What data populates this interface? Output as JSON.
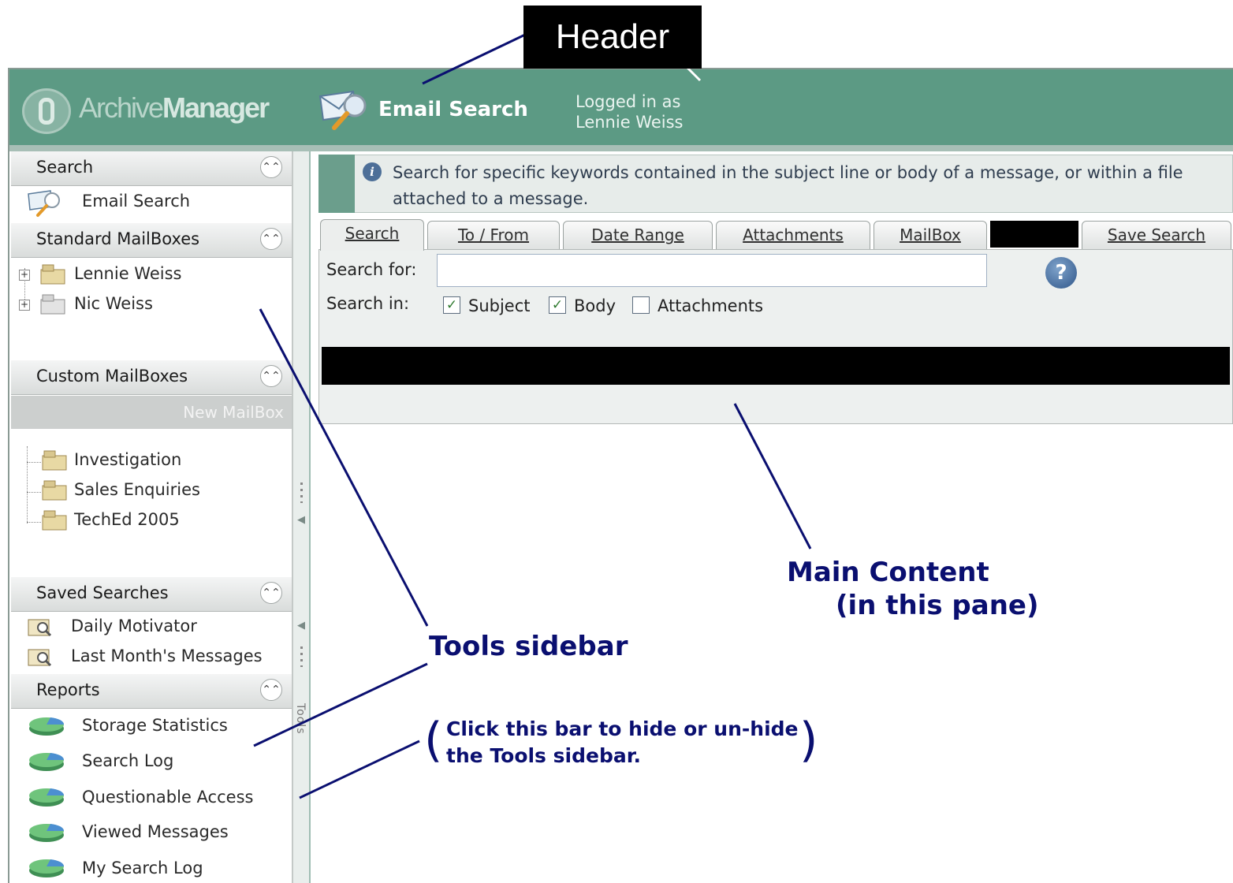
{
  "annotations": {
    "header": "Header",
    "main_content_line1": "Main Content",
    "main_content_line2": "(in this pane)",
    "tools_sidebar": "Tools sidebar",
    "toggle_line1": "Click this bar to hide or un-hide",
    "toggle_line2": "the Tools sidebar."
  },
  "header": {
    "logo_light": "Archive",
    "logo_bold": "Manager",
    "page_title": "Email Search",
    "logged_in_line1": "Logged in as",
    "logged_in_line2": "Lennie Weiss",
    "accent_color": "#5c9a84"
  },
  "sidebar": {
    "search": {
      "title": "Search",
      "items": [
        "Email Search"
      ]
    },
    "standard_mailboxes": {
      "title": "Standard MailBoxes",
      "items": [
        "Lennie Weiss",
        "Nic Weiss"
      ]
    },
    "custom_mailboxes": {
      "title": "Custom MailBoxes",
      "new_label": "New MailBox",
      "items": [
        "Investigation",
        "Sales Enquiries",
        "TechEd 2005"
      ]
    },
    "saved_searches": {
      "title": "Saved Searches",
      "items": [
        "Daily Motivator",
        "Last Month's Messages"
      ]
    },
    "reports": {
      "title": "Reports",
      "items": [
        "Storage Statistics",
        "Search Log",
        "Questionable Access",
        "Viewed Messages",
        "My Search Log"
      ]
    },
    "tools_label": "Tools"
  },
  "main": {
    "info": "Search for specific keywords contained in the subject line or body of a message, or within a file attached to a message.",
    "tabs": [
      "Search",
      "To / From",
      "Date Range",
      "Attachments",
      "MailBox",
      "Save Search"
    ],
    "search_for_label": "Search for:",
    "search_for_value": "",
    "search_in_label": "Search in:",
    "checkboxes": [
      {
        "label": "Subject",
        "checked": true
      },
      {
        "label": "Body",
        "checked": true
      },
      {
        "label": "Attachments",
        "checked": false
      }
    ]
  }
}
